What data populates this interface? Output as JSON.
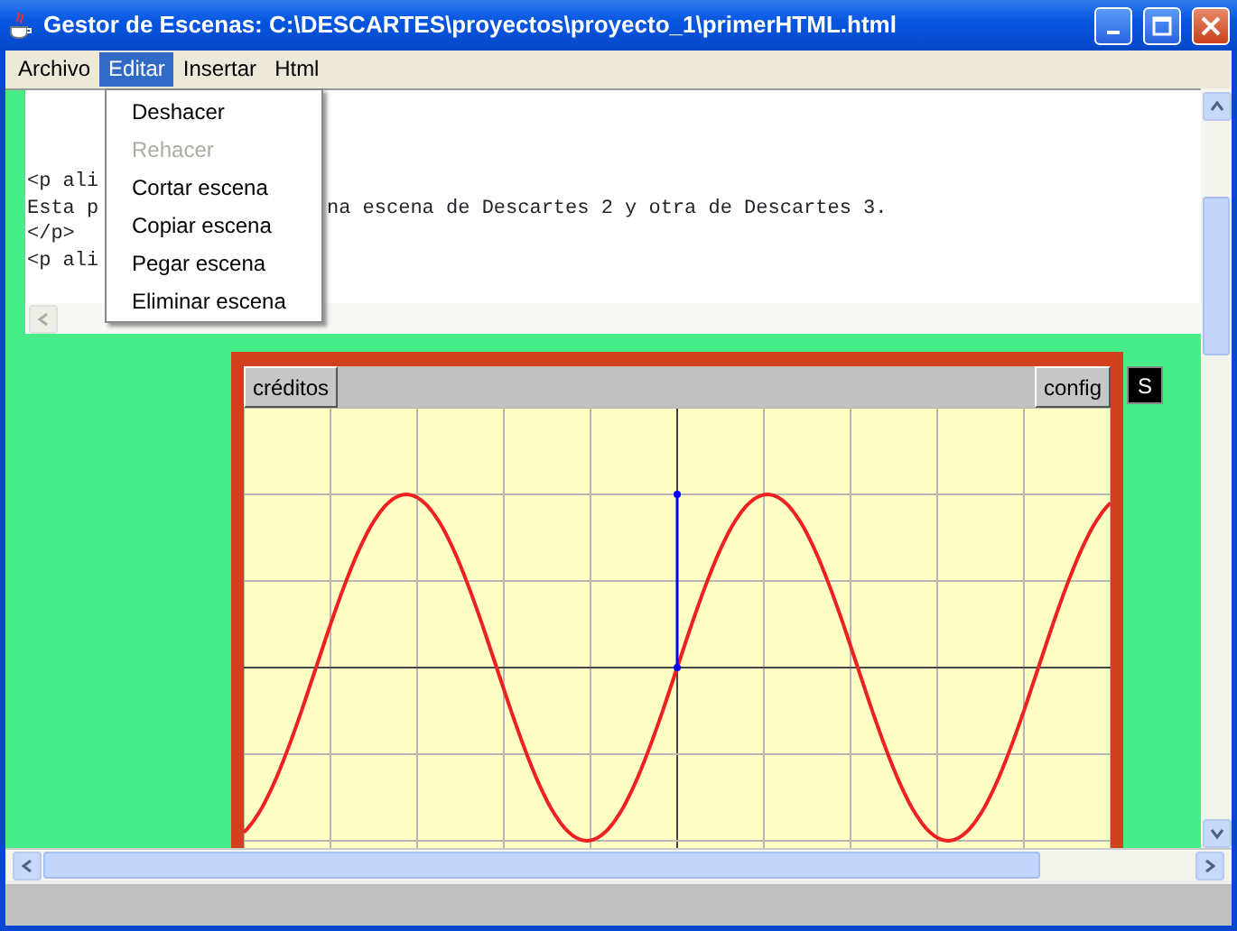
{
  "window": {
    "title": "Gestor de Escenas: C:\\DESCARTES\\proyectos\\proyecto_1\\primerHTML.html"
  },
  "menu_bar": [
    {
      "label": "Archivo",
      "selected": false
    },
    {
      "label": "Editar",
      "selected": true
    },
    {
      "label": "Insertar",
      "selected": false
    },
    {
      "label": "Html",
      "selected": false
    }
  ],
  "dropdown": [
    {
      "label": "Deshacer",
      "disabled": false
    },
    {
      "label": "Rehacer",
      "disabled": true
    },
    {
      "label": "Cortar escena",
      "disabled": false
    },
    {
      "label": "Copiar escena",
      "disabled": false
    },
    {
      "label": "Pegar escena",
      "disabled": false
    },
    {
      "label": "Eliminar escena",
      "disabled": false
    }
  ],
  "editor": {
    "lines": [
      {
        "left": "<p ali"
      },
      {
        "left": "Esta p",
        "right": "na escena de Descartes 2 y otra de Descartes 3."
      },
      {
        "left": "</p>"
      },
      {
        "left": "<p ali"
      }
    ]
  },
  "applet": {
    "buttons": [
      "créditos",
      "config"
    ],
    "side_button": "S"
  }
}
